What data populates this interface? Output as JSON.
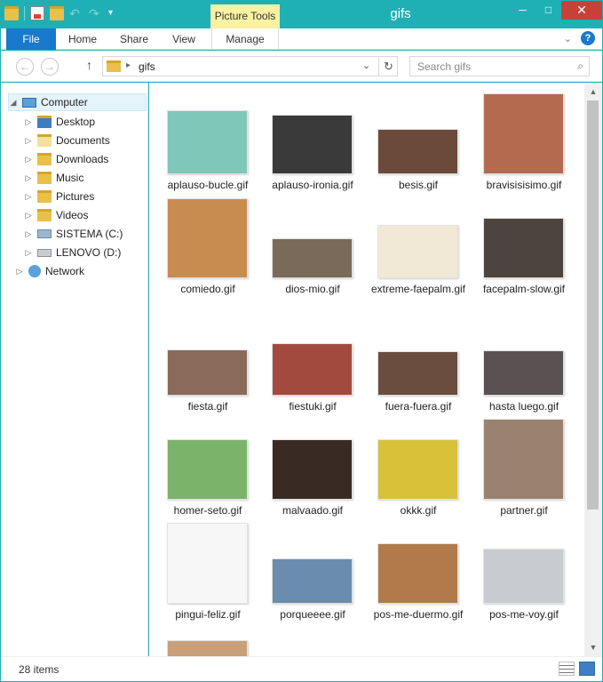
{
  "window": {
    "title": "gifs",
    "context_tab": "Picture Tools",
    "controls": {
      "minimize": "─",
      "maximize": "□",
      "close": "✕"
    }
  },
  "quick_access": {
    "items": [
      "folder-icon",
      "properties-icon",
      "new-folder-icon",
      "undo-icon",
      "redo-icon",
      "customize-icon"
    ]
  },
  "ribbon": {
    "tabs": [
      {
        "label": "File"
      },
      {
        "label": "Home"
      },
      {
        "label": "Share"
      },
      {
        "label": "View"
      },
      {
        "label": "Manage"
      }
    ],
    "help": "?"
  },
  "address": {
    "back": "←",
    "forward": "→",
    "up": "↑",
    "path": "gifs",
    "refresh": "↻",
    "search_placeholder": "Search gifs"
  },
  "nav_pane": {
    "items": [
      {
        "label": "Computer",
        "icon": "computer-icon"
      },
      {
        "label": "Desktop",
        "icon": "desktop-icon"
      },
      {
        "label": "Documents",
        "icon": "documents-icon"
      },
      {
        "label": "Downloads",
        "icon": "downloads-icon"
      },
      {
        "label": "Music",
        "icon": "music-icon"
      },
      {
        "label": "Pictures",
        "icon": "pictures-icon"
      },
      {
        "label": "Videos",
        "icon": "videos-icon"
      },
      {
        "label": "SISTEMA (C:)",
        "icon": "drive-icon"
      },
      {
        "label": "LENOVO (D:)",
        "icon": "drive-icon"
      },
      {
        "label": "Network",
        "icon": "network-icon"
      }
    ]
  },
  "files": [
    {
      "name": "aplauso-bucle.gif",
      "bg": "#7fc7b9"
    },
    {
      "name": "aplauso-ironia.gif",
      "bg": "#3a3a3a"
    },
    {
      "name": "besis.gif",
      "bg": "#6b4a3a"
    },
    {
      "name": "bravisisisimo.gif",
      "bg": "#b46a4e"
    },
    {
      "name": "comiedo.gif",
      "bg": "#c98c4f"
    },
    {
      "name": "dios-mio.gif",
      "bg": "#7a6a5a"
    },
    {
      "name": "extreme-faepalm.gif",
      "bg": "#f1e9d6"
    },
    {
      "name": "facepalm-slow.gif",
      "bg": "#4d4440"
    },
    {
      "name": "fiesta.gif",
      "bg": "#8a6a5a"
    },
    {
      "name": "fiestuki.gif",
      "bg": "#a34a3e"
    },
    {
      "name": "fuera-fuera.gif",
      "bg": "#6a4d3e"
    },
    {
      "name": "hasta luego.gif",
      "bg": "#5a5252"
    },
    {
      "name": "homer-seto.gif",
      "bg": "#7ab36a"
    },
    {
      "name": "malvaado.gif",
      "bg": "#3a2a24"
    },
    {
      "name": "okkk.gif",
      "bg": "#d8c23a"
    },
    {
      "name": "partner.gif",
      "bg": "#9a8270"
    },
    {
      "name": "pingui-feliz.gif",
      "bg": "#f7f7f7"
    },
    {
      "name": "porqueeee.gif",
      "bg": "#6a8cae"
    },
    {
      "name": "pos-me-duermo.gif",
      "bg": "#b07a4a"
    },
    {
      "name": "pos-me-voy.gif",
      "bg": "#c8ccd0"
    },
    {
      "name": "",
      "bg": "#c9a07a"
    }
  ],
  "status": {
    "count": "28 items"
  }
}
